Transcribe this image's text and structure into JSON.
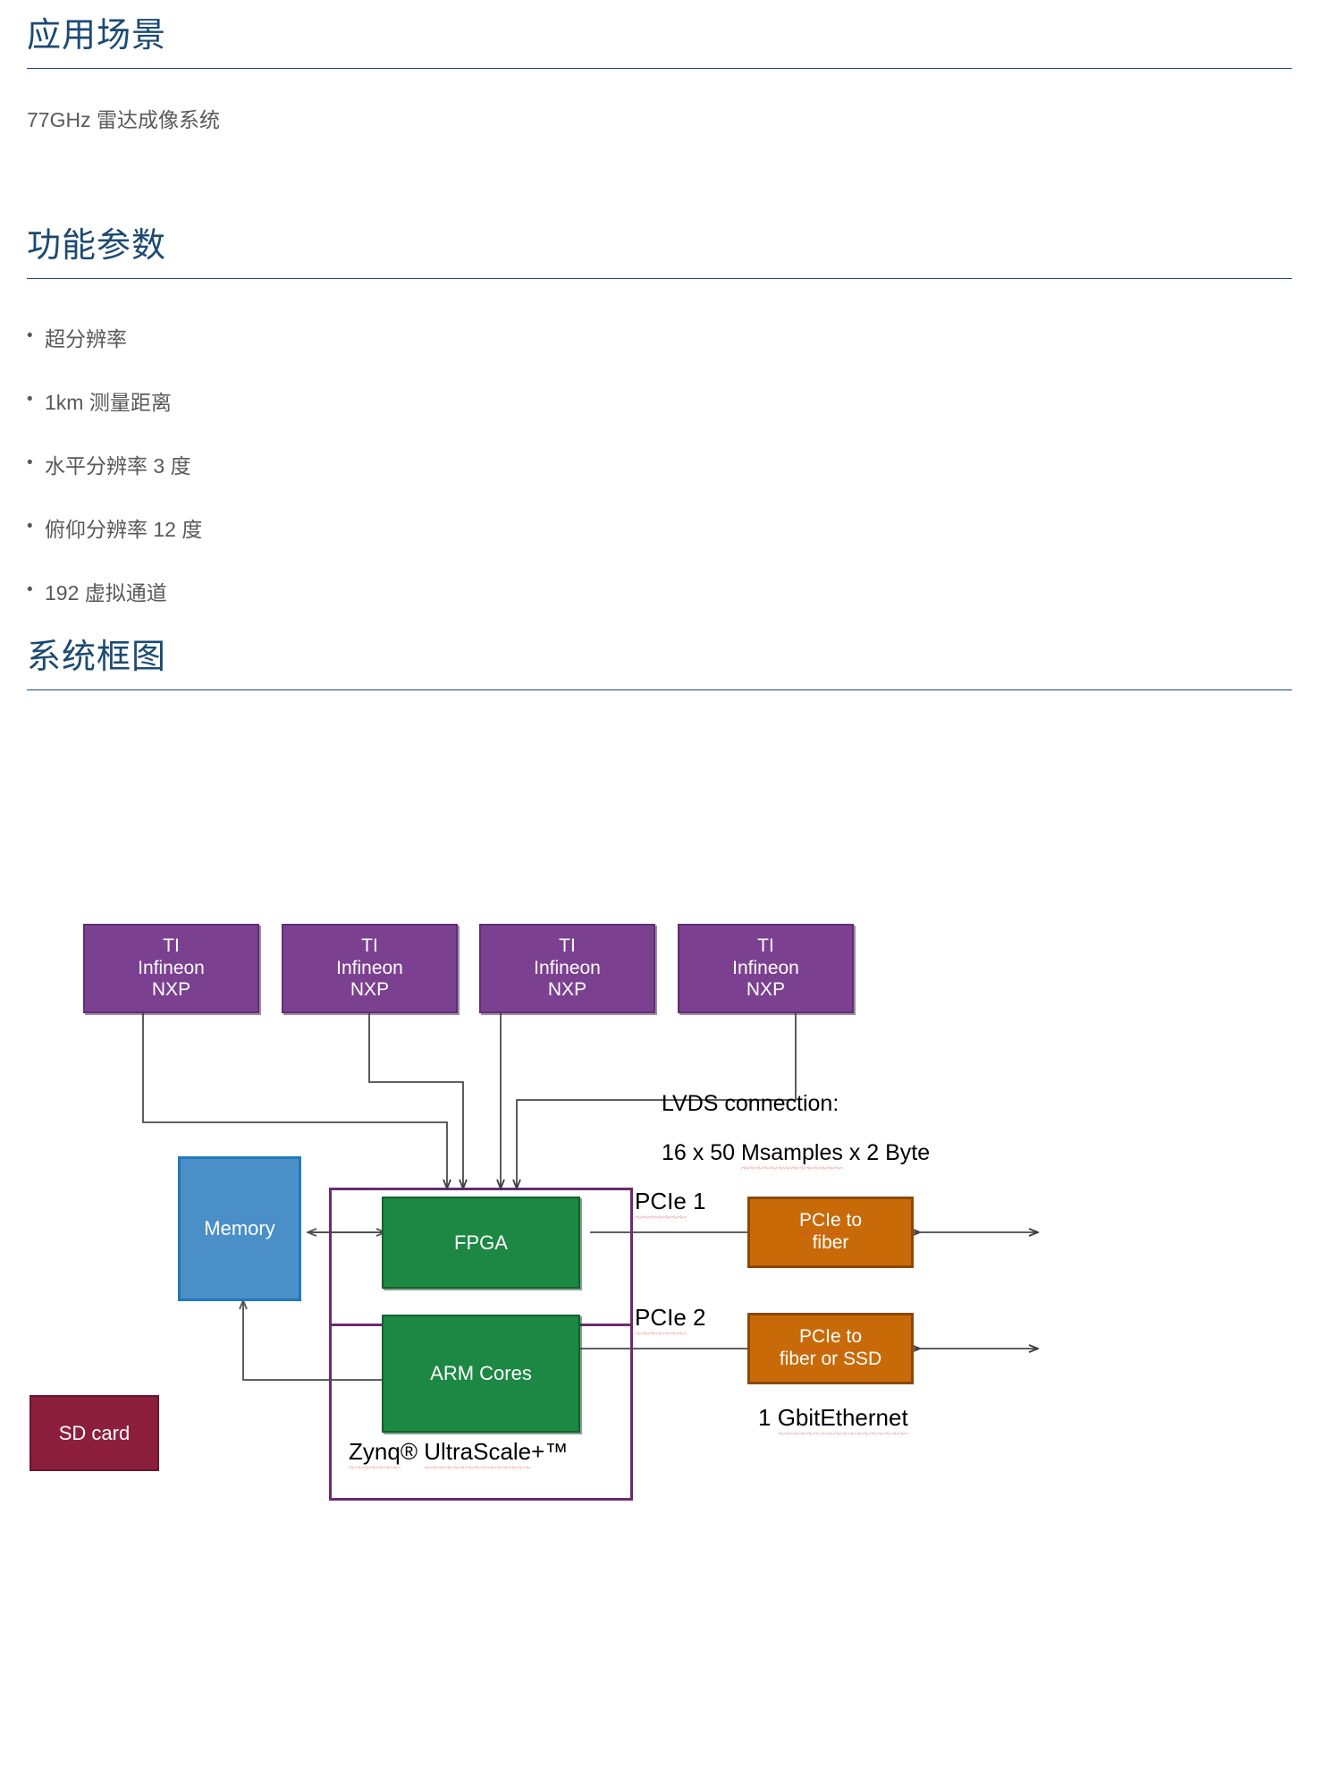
{
  "sections": [
    {
      "title": "应用场景",
      "body": "77GHz 雷达成像系统"
    },
    {
      "title": "功能参数",
      "bullets": [
        "超分辨率",
        "1km 测量距离",
        "水平分辨率 3 度",
        "俯仰分辨率 12 度",
        "192 虚拟通道"
      ]
    },
    {
      "title": "系统框图"
    }
  ],
  "diagram": {
    "sensors": [
      {
        "l1": "TI",
        "l2": "Infineon",
        "l3": "NXP"
      },
      {
        "l1": "TI",
        "l2": "Infineon",
        "l3": "NXP"
      },
      {
        "l1": "TI",
        "l2": "Infineon",
        "l3": "NXP"
      },
      {
        "l1": "TI",
        "l2": "Infineon",
        "l3": "NXP"
      }
    ],
    "memory_label": "Memory",
    "fpga_label": "FPGA",
    "arm_label": "ARM Cores",
    "sdcard_label": "SD card",
    "zynq_label_a": "Zynq",
    "zynq_label_b": "® ",
    "zynq_label_c": "UltraScale",
    "zynq_label_d": "+™",
    "lvds_line1": "LVDS  connection:",
    "lvds_line2_a": "16 x 50 ",
    "lvds_line2_b": "Msamples",
    "lvds_line2_c": " x 2 Byte",
    "pcie1_label_a": "PCIe",
    "pcie1_label_b": " 1",
    "pcie2_label_a": "PCIe",
    "pcie2_label_b": " 2",
    "pcie_box1_a": "PCIe",
    "pcie_box1_b": " to",
    "pcie_box1_c": "fiber",
    "pcie_box2_a": "PCIe",
    "pcie_box2_b": " to",
    "pcie_box2_c": "fiber or SSD",
    "ethernet_a": "1 ",
    "ethernet_b": "Gbit",
    "ethernet_c": " Ethernet",
    "colors": {
      "heading": "#1b4a73",
      "body": "#595959",
      "sensor": "#7c4091",
      "memory": "#4a8fc8",
      "processor": "#1c8843",
      "sdcard": "#8c1f3d",
      "pcie": "#c96a09",
      "zynq_frame": "#6a2c6e",
      "wire": "#4a4a4a",
      "spellcheck": "#e8413a"
    }
  }
}
